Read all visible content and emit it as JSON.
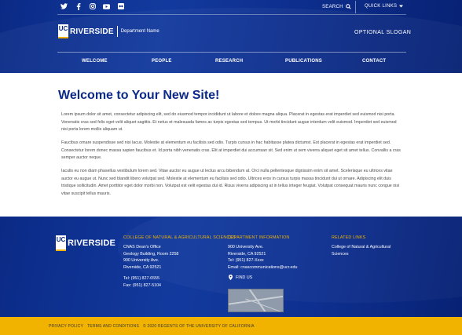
{
  "header": {
    "social_icons": [
      "twitter-icon",
      "facebook-icon",
      "instagram-icon",
      "youtube-icon",
      "flickr-icon"
    ],
    "search_label": "SEARCH",
    "quick_links_label": "QUICK LINKS",
    "brand_uc": "UC",
    "brand_name": "RIVERSIDE",
    "department_name": "Department Name",
    "slogan": "OPTIONAL SLOGAN",
    "nav": [
      {
        "label": "WELCOME"
      },
      {
        "label": "PEOPLE"
      },
      {
        "label": "RESEARCH"
      },
      {
        "label": "PUBLICATIONS"
      },
      {
        "label": "CONTACT"
      }
    ]
  },
  "main": {
    "title": "Welcome to Your New Site!",
    "paragraphs": [
      "Lorem ipsum dolor sit amet, consectetur adipiscing elit, sed do eiusmod tempor incididunt ut labore et dolore magna aliqua. Placerat in egestas erat imperdiet sed euismod nisi porta. Venenatis cras sed felis eget velit aliquet sagittis. Et netus et malesuada fames ac turpis egestas sed tempus. Ut morbi tincidunt augue interdum velit euismod. Imperdiet sed euismod nisi porta lorem mollis aliquam ut.",
      "Faucibus ornare suspendisse sed nisi lacus. Molestie at elementum eu facilisis sed odio. Turpis cursus in hac habitasse platea dictumst. Est placerat in egestas erat imperdiet sed. Consectetur lorem donec massa sapien faucibus et. Id porta nibh venenatis cras. Elit at imperdiet dui accumsan sit. Sed enim ut sem viverra aliquet eget sit amet tellus. Convallis a cras semper auctor neque.",
      "Iaculis eu non diam phasellus vestibulum lorem sed. Vitae auctor eu augue ut lectus arcu bibendum at. Orci nulla pellentesque dignissim enim sit amet. Scelerisque eu ultrices vitae auctor eu augue ut. Nunc sed blandit libero volutpat sed. Molestie at elementum eu facilisis sed odio. Ultrices eros in cursus turpis massa tincidunt dui ut ornare. Adipiscing elit duis tristique sollicitudin. Amet porttitor eget dolor morbi non. Volutpat est velit egestas dui id. Risus viverra adipiscing at in tellus integer feugiat. Volutpat consequat mauris nunc congue nisi vitae suscipit tellus mauris."
    ]
  },
  "footer": {
    "brand_uc": "UC",
    "brand_name": "RIVERSIDE",
    "college_heading": "COLLEGE OF NATURAL & AGRICULTURAL SCIENCES",
    "college_address": [
      "CNAS Dean's Office",
      "Geology Building, Room 2258",
      "900 University Ave.",
      "Riverside, CA 92521"
    ],
    "college_tel": "Tel: (951) 827-6555",
    "college_fax": "Fax: (951) 827-5104",
    "dept_heading": "DEPARTMENT INFORMATION",
    "dept_info": [
      "900 University Ave.",
      "Riverside, CA 92521",
      "Tel: (951) 827-Xxxx",
      "Email: cnascommunications@ucr.edu"
    ],
    "find_us": "FIND US",
    "related_heading": "RELATED LINKS",
    "related_links": [
      "College of Natural & Agricultural",
      "Sciences"
    ]
  },
  "bottom_bar": {
    "privacy": "PRIVACY POLICY",
    "terms": "TERMS AND CONDITIONS",
    "copyright": "© 2020 REGENTS OF THE UNIVERSITY OF CALIFORNIA"
  },
  "colors": {
    "primary_blue": "#0b2a86",
    "gold": "#f1b300"
  }
}
